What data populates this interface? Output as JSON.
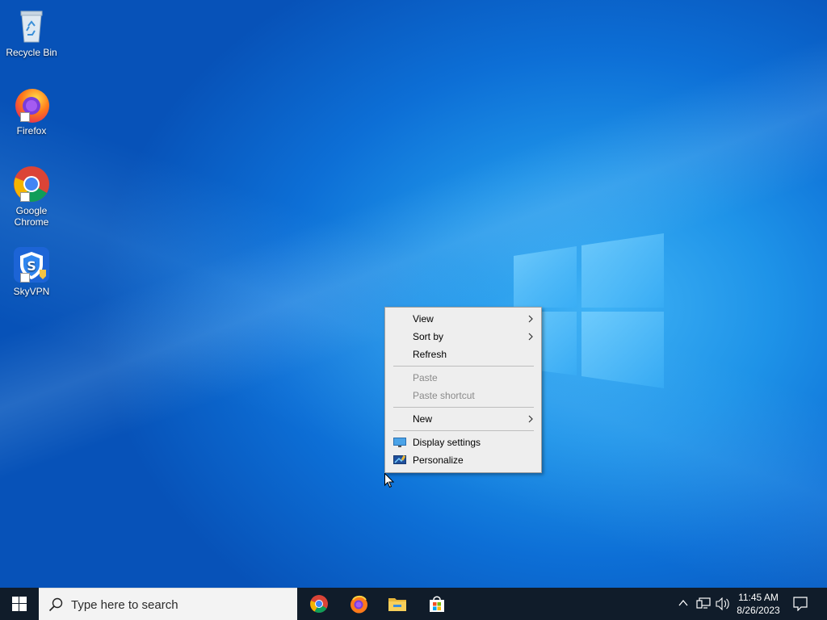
{
  "desktop": {
    "icons": [
      {
        "label_line1": "Recycle Bin",
        "label_line2": "",
        "icon": "recycle-bin-icon"
      },
      {
        "label_line1": "Firefox",
        "label_line2": "",
        "icon": "firefox-icon"
      },
      {
        "label_line1": "Google",
        "label_line2": "Chrome",
        "icon": "chrome-icon"
      },
      {
        "label_line1": "SkyVPN",
        "label_line2": "",
        "icon": "skyvpn-icon"
      }
    ]
  },
  "context_menu": {
    "items": [
      {
        "label": "View",
        "enabled": true,
        "submenu": true
      },
      {
        "label": "Sort by",
        "enabled": true,
        "submenu": true
      },
      {
        "label": "Refresh",
        "enabled": true,
        "submenu": false
      },
      {
        "label": "Paste",
        "enabled": false,
        "submenu": false
      },
      {
        "label": "Paste shortcut",
        "enabled": false,
        "submenu": false
      },
      {
        "label": "New",
        "enabled": true,
        "submenu": true
      },
      {
        "label": "Display settings",
        "enabled": true,
        "submenu": false,
        "icon": "display-settings-icon"
      },
      {
        "label": "Personalize",
        "enabled": true,
        "submenu": false,
        "icon": "personalize-icon"
      }
    ]
  },
  "taskbar": {
    "search_placeholder": "Type here to search",
    "pinned_apps": [
      "chrome-icon",
      "firefox-icon",
      "file-explorer-icon",
      "microsoft-store-icon"
    ],
    "tray_icons": [
      "chevron-up-icon",
      "network-icon",
      "volume-icon"
    ],
    "clock": {
      "time": "11:45 AM",
      "date": "8/26/2023"
    },
    "notification_icon": "action-center-icon"
  },
  "colors": {
    "desktop_bg": "#0d6fd6",
    "taskbar_bg": "#101c2a",
    "menu_bg": "#eeeeee",
    "disabled_text": "#8a8a8a"
  }
}
